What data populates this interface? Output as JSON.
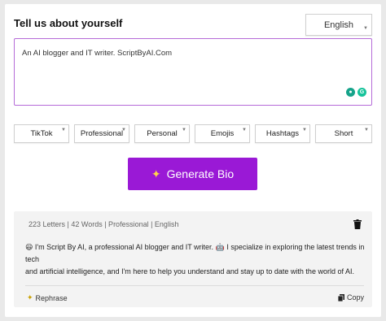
{
  "header": {
    "title": "Tell us about yourself",
    "language": "English"
  },
  "input": {
    "value": "An AI blogger and IT writer. ScriptByAI.Com"
  },
  "options": [
    "TikTok",
    "Professional",
    "Personal",
    "Emojis",
    "Hashtags",
    "Short"
  ],
  "generate": {
    "label": "Generate Bio"
  },
  "result": {
    "meta": "223 Letters | 42 Words | Professional | English",
    "line1": "I'm Script By AI, a professional AI blogger and IT writer.",
    "line1_end": "I specialize in exploring the latest trends in tech",
    "line2": "and artificial intelligence, and I'm here to help you understand and stay up to date with the world of AI.",
    "rephrase_label": "Rephrase",
    "copy_label": "Copy"
  },
  "colors": {
    "accent": "#9a19d6",
    "border_active": "#b56ad8"
  }
}
